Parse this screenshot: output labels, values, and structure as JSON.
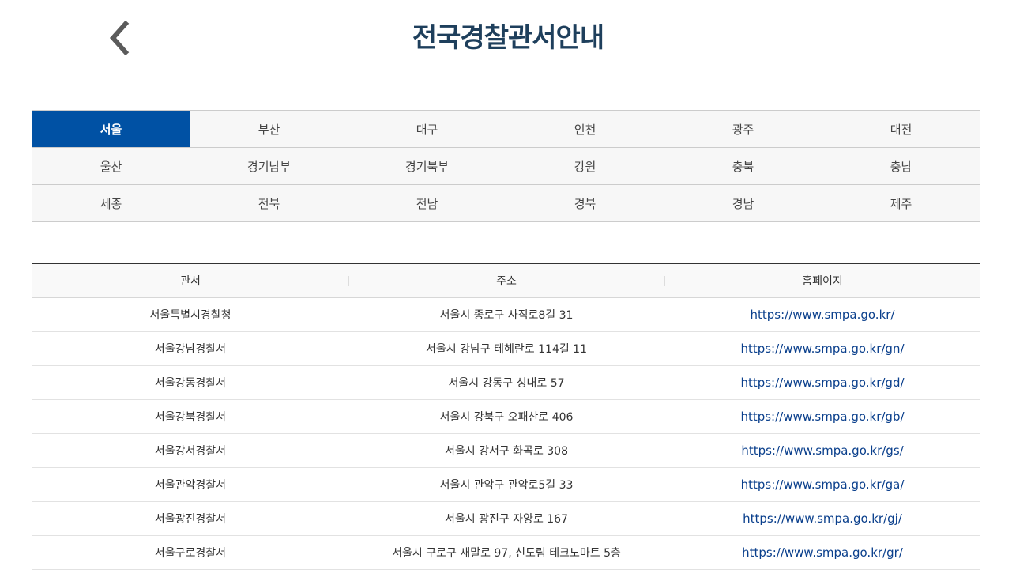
{
  "header": {
    "title": "전국경찰관서안내",
    "back_icon": "chevron-left-icon"
  },
  "regions": [
    {
      "label": "서울",
      "active": true
    },
    {
      "label": "부산",
      "active": false
    },
    {
      "label": "대구",
      "active": false
    },
    {
      "label": "인천",
      "active": false
    },
    {
      "label": "광주",
      "active": false
    },
    {
      "label": "대전",
      "active": false
    },
    {
      "label": "울산",
      "active": false
    },
    {
      "label": "경기남부",
      "active": false
    },
    {
      "label": "경기북부",
      "active": false
    },
    {
      "label": "강원",
      "active": false
    },
    {
      "label": "충북",
      "active": false
    },
    {
      "label": "충남",
      "active": false
    },
    {
      "label": "세종",
      "active": false
    },
    {
      "label": "전북",
      "active": false
    },
    {
      "label": "전남",
      "active": false
    },
    {
      "label": "경북",
      "active": false
    },
    {
      "label": "경남",
      "active": false
    },
    {
      "label": "제주",
      "active": false
    }
  ],
  "table": {
    "headers": [
      "관서",
      "주소",
      "홈페이지"
    ],
    "rows": [
      {
        "name": "서울특별시경찰청",
        "address": "서울시 종로구 사직로8길 31",
        "url": "https://www.smpa.go.kr/"
      },
      {
        "name": "서울강남경찰서",
        "address": "서울시 강남구 테헤란로 114길 11",
        "url": "https://www.smpa.go.kr/gn/"
      },
      {
        "name": "서울강동경찰서",
        "address": "서울시 강동구 성내로 57",
        "url": "https://www.smpa.go.kr/gd/"
      },
      {
        "name": "서울강북경찰서",
        "address": "서울시 강북구 오패산로 406",
        "url": "https://www.smpa.go.kr/gb/"
      },
      {
        "name": "서울강서경찰서",
        "address": "서울시 강서구 화곡로 308",
        "url": "https://www.smpa.go.kr/gs/"
      },
      {
        "name": "서울관악경찰서",
        "address": "서울시 관악구 관악로5길 33",
        "url": "https://www.smpa.go.kr/ga/"
      },
      {
        "name": "서울광진경찰서",
        "address": "서울시 광진구 자양로 167",
        "url": "https://www.smpa.go.kr/gj/"
      },
      {
        "name": "서울구로경찰서",
        "address": "서울시 구로구 새말로 97, 신도림 테크노마트 5층",
        "url": "https://www.smpa.go.kr/gr/"
      }
    ]
  },
  "colors": {
    "accent": "#0051a4",
    "title": "#1e3f5c",
    "link": "#0a3f8c"
  }
}
